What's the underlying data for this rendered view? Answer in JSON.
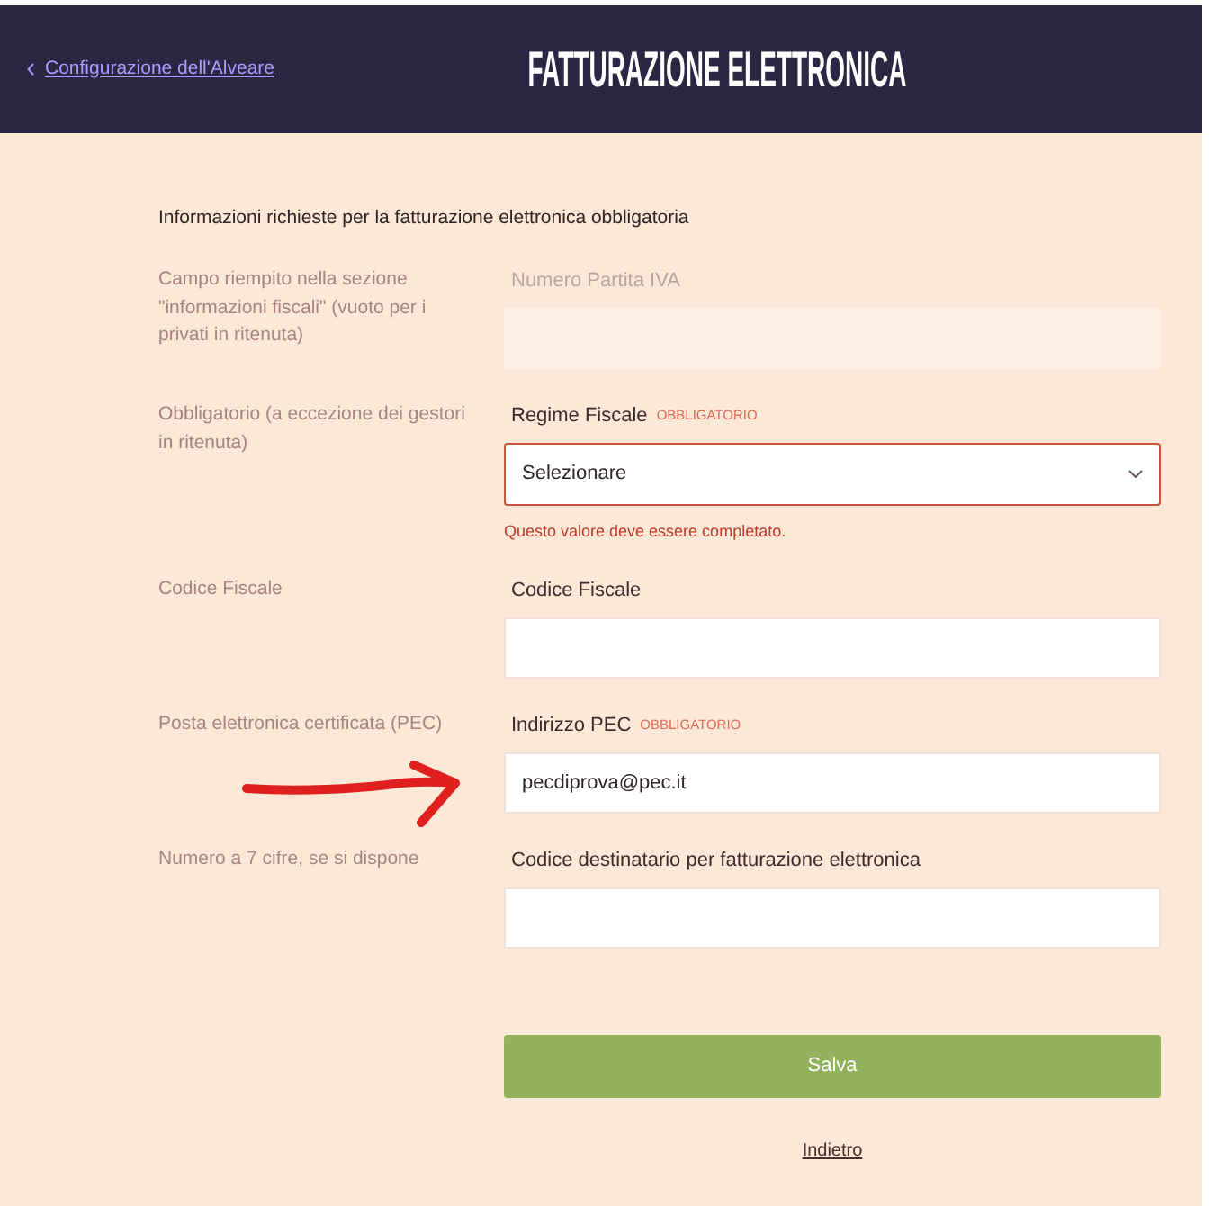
{
  "header": {
    "back_link": "Configurazione dell'Alveare",
    "title": "FATTURAZIONE ELETTRONICA"
  },
  "form": {
    "intro": "Informazioni richieste per la fatturazione elettronica obbligatoria",
    "fields": [
      {
        "kind": "input",
        "description": "Campo riempito nella sezione \"informazioni fiscali\" (vuoto per i privati in ritenuta)",
        "label": "Numero Partita IVA",
        "disabled": true,
        "invalid": false
      },
      {
        "kind": "select",
        "description": "Obbligatorio (a eccezione dei gestori in ritenuta)",
        "label": "Regime Fiscale",
        "required_tag": "OBBLIGATORIO",
        "value": "Selezionare",
        "disabled": false,
        "invalid": true,
        "error": "Questo valore deve essere completato."
      },
      {
        "kind": "input",
        "description": "Codice Fiscale",
        "label": "Codice Fiscale",
        "disabled": false,
        "invalid": false
      },
      {
        "kind": "input",
        "description": "Posta elettronica certificata (PEC)",
        "label": "Indirizzo PEC",
        "required_tag": "OBBLIGATORIO",
        "value": "pecdiprova@pec.it",
        "disabled": false,
        "invalid": false
      },
      {
        "kind": "input",
        "description": "Numero a 7 cifre, se si dispone",
        "label": "Codice destinatario per fatturazione elettronica",
        "disabled": false,
        "invalid": false
      }
    ],
    "submit_button": "Salva",
    "back_link": "Indietro"
  }
}
